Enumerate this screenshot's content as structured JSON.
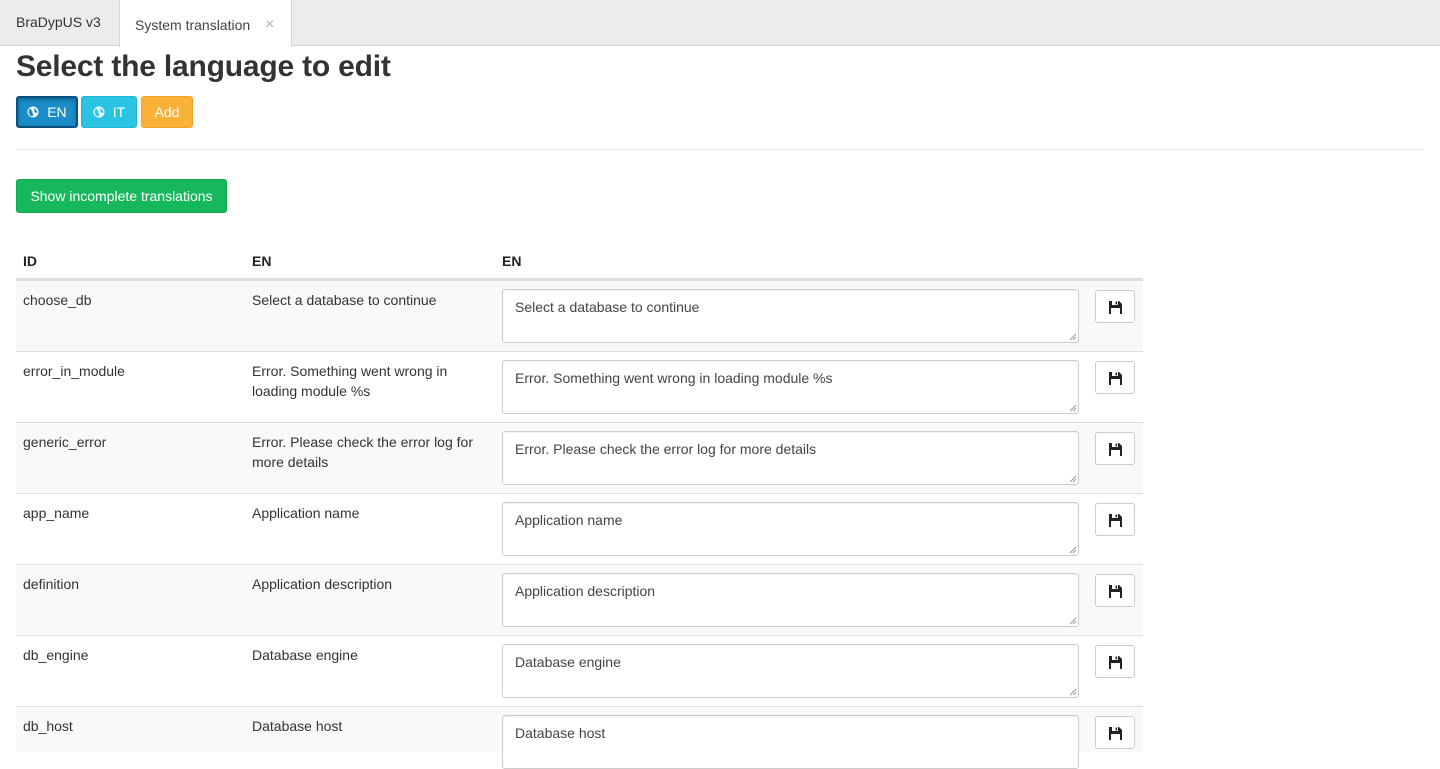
{
  "tabs": {
    "home_label": "BraDypUS v3",
    "active_label": "System translation",
    "close_glyph": "×"
  },
  "header": {
    "title": "Select the language to edit"
  },
  "language_buttons": [
    {
      "label": "EN",
      "icon": "globe-icon",
      "active": true
    },
    {
      "label": "IT",
      "icon": "globe-icon",
      "active": false
    }
  ],
  "add_label": "Add",
  "show_incomplete_label": "Show incomplete translations",
  "table": {
    "headers": [
      "ID",
      "EN",
      "EN"
    ],
    "rows": [
      {
        "id": "choose_db",
        "source": "Select a database to continue",
        "value": "Select a database to continue"
      },
      {
        "id": "error_in_module",
        "source": "Error. Something went wrong in loading module %s",
        "value": "Error. Something went wrong in loading module %s"
      },
      {
        "id": "generic_error",
        "source": "Error. Please check the error log for more details",
        "value": "Error. Please check the error log for more details"
      },
      {
        "id": "app_name",
        "source": "Application name",
        "value": "Application name"
      },
      {
        "id": "definition",
        "source": "Application description",
        "value": "Application description"
      },
      {
        "id": "db_engine",
        "source": "Database engine",
        "value": "Database engine"
      },
      {
        "id": "db_host",
        "source": "Database host",
        "value": "Database host"
      }
    ]
  },
  "colors": {
    "en_button": "#1a8cc7",
    "it_button": "#2bc4e4",
    "add_button": "#f9b138",
    "show_button": "#17b85c"
  }
}
